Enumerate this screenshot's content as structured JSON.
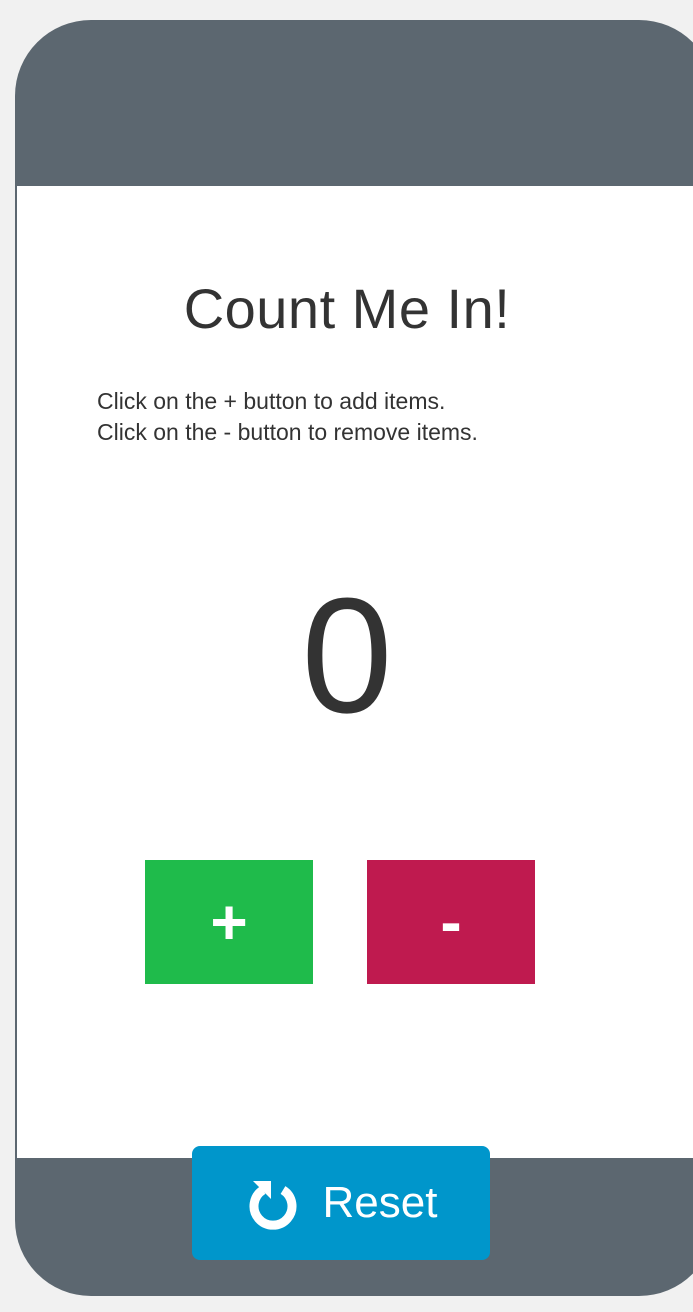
{
  "app": {
    "title": "Count Me In!",
    "instructions": [
      "Click on the + button to add items.",
      "Click on the - button to remove items."
    ],
    "count": "0"
  },
  "buttons": {
    "increment_label": "+",
    "decrement_label": "-",
    "reset_label": "Reset"
  },
  "colors": {
    "frame": "#5c6770",
    "screen": "#ffffff",
    "increment": "#1fbb4b",
    "decrement": "#bf1a4f",
    "reset": "#0096cb",
    "text": "#333333"
  },
  "icons": {
    "reset_icon": "reset-arrow-icon"
  }
}
